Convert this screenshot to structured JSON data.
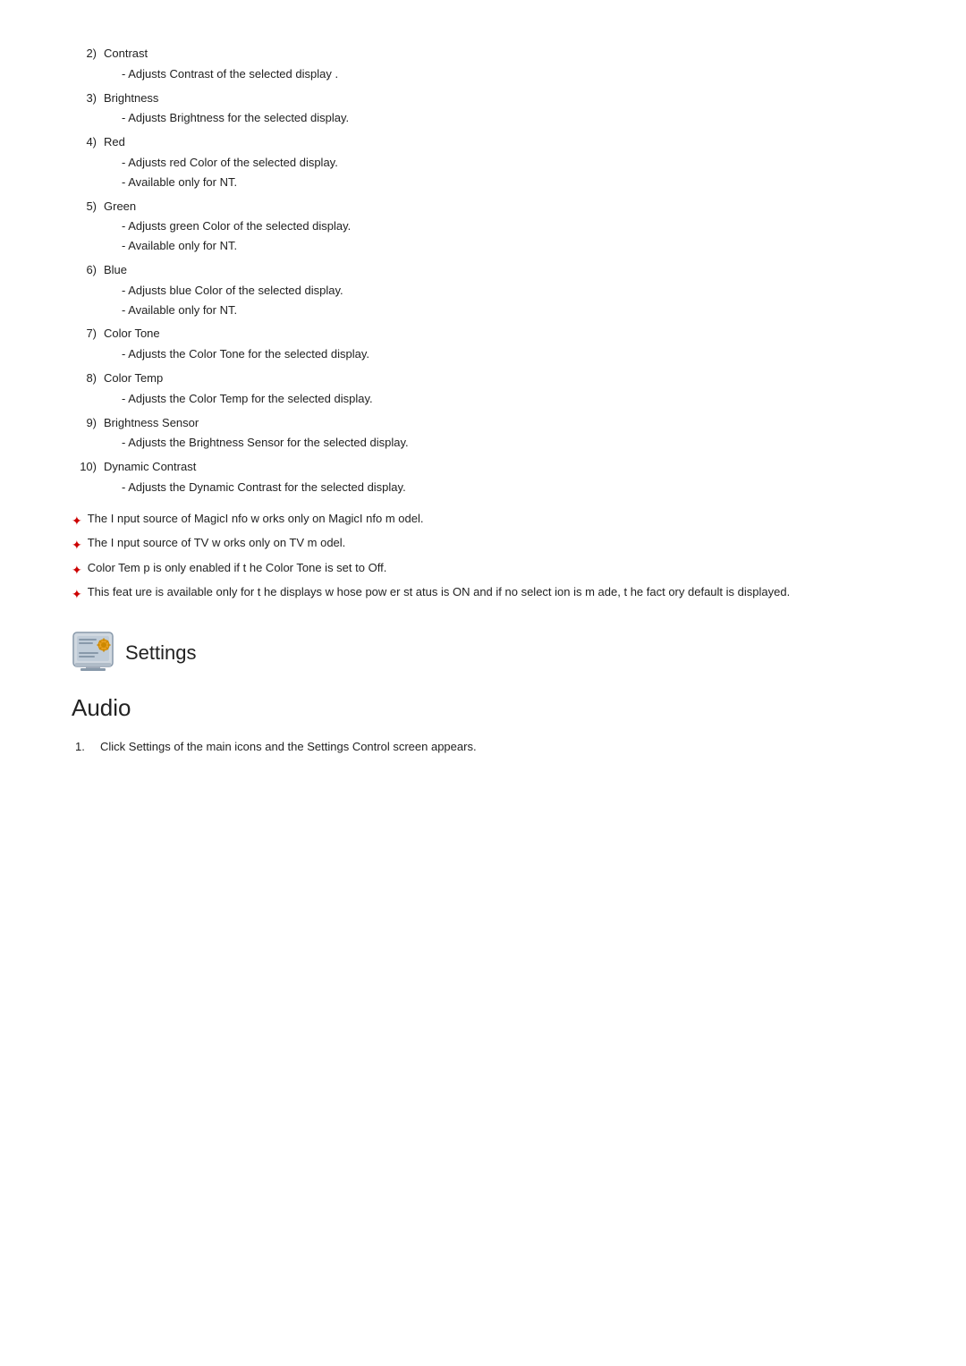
{
  "items": [
    {
      "number": "2)",
      "title": "Contrast",
      "descriptions": [
        "- Adjusts Contrast of the selected display ."
      ]
    },
    {
      "number": "3)",
      "title": "Brightness",
      "descriptions": [
        "- Adjusts Brightness for the selected display."
      ]
    },
    {
      "number": "4)",
      "title": "Red",
      "descriptions": [
        "- Adjusts red Color of the selected display.",
        "- Available  only for NT."
      ]
    },
    {
      "number": "5)",
      "title": "Green",
      "descriptions": [
        "- Adjusts green Color of the selected display.",
        "- Available  only for NT."
      ]
    },
    {
      "number": "6)",
      "title": "Blue",
      "descriptions": [
        "- Adjusts blue Color of the selected display.",
        "- Available  only for NT."
      ]
    },
    {
      "number": "7)",
      "title": "Color Tone",
      "descriptions": [
        "- Adjusts the Color Tone for the selected display."
      ]
    },
    {
      "number": "8)",
      "title": "Color Temp",
      "descriptions": [
        "- Adjusts the Color Temp for the selected display."
      ]
    },
    {
      "number": "9)",
      "title": "Brightness Sensor",
      "descriptions": [
        "- Adjusts the Brightness Sensor for the selected display."
      ]
    },
    {
      "number": "10)",
      "title": "Dynamic Contrast",
      "descriptions": [
        "- Adjusts the Dynamic Contrast for the selected display."
      ]
    }
  ],
  "notes": [
    "The I nput source of MagicI nfo w orks only on MagicI nfo m odel.",
    "The I nput source of TV w orks only on TV m odel.",
    "Color Tem p is only enabled if t he Color Tone is set to Off.",
    "This feat ure is available only for t he displays w hose pow er st atus is ON and if no select ion is m ade, t he  fact ory default is displayed."
  ],
  "settings_section": {
    "title": "Settings"
  },
  "audio_section": {
    "title": "Audio",
    "steps": [
      {
        "number": "1.",
        "text": "Click Settings of the main icons and the Settings Control screen appears."
      }
    ]
  }
}
